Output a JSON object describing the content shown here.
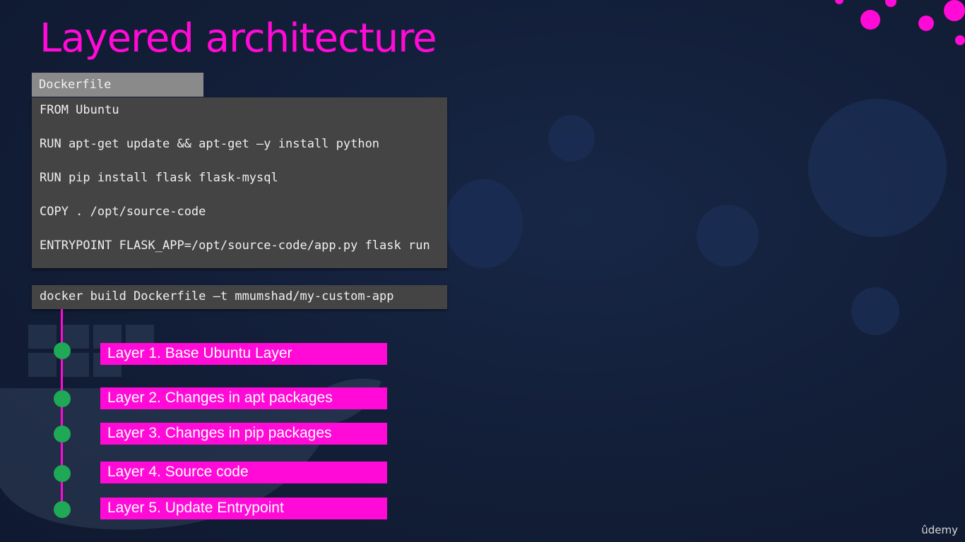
{
  "slide": {
    "title": "Layered architecture",
    "accent_color": "#ff0ad6",
    "dot_color": "#1fa855",
    "background_color": "#14213d"
  },
  "dockerfile": {
    "tab_label": "Dockerfile",
    "lines": [
      "FROM Ubuntu",
      "RUN apt-get update && apt-get –y install python",
      "RUN pip install flask flask-mysql",
      "COPY . /opt/source-code",
      "ENTRYPOINT FLASK_APP=/opt/source-code/app.py flask run"
    ]
  },
  "command": "docker build Dockerfile –t mmumshad/my-custom-app",
  "layers": [
    "Layer 1. Base Ubuntu Layer",
    "Layer 2. Changes in apt packages",
    "Layer 3. Changes in pip packages",
    "Layer 4. Source code",
    "Layer 5. Update Entrypoint"
  ],
  "watermark": "ûdemy"
}
